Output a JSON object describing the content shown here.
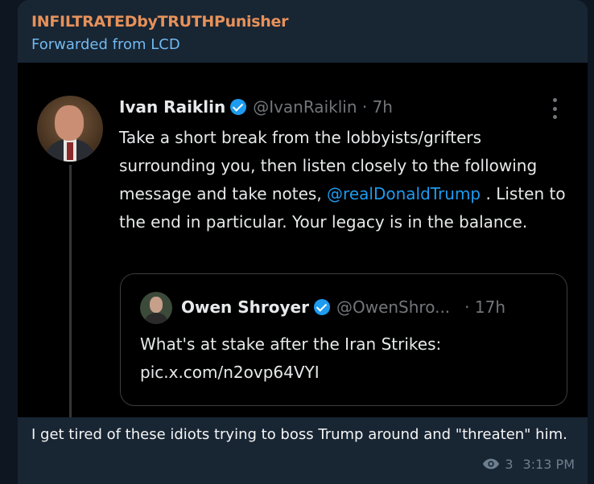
{
  "message": {
    "sender": "INFILTRATEDbyTRUTHPunisher",
    "forwarded_from": "Forwarded from LCD",
    "caption": "I get tired of these idiots trying to boss Trump around and \"threaten\" him.",
    "views": "3",
    "time": "3:13 PM"
  },
  "tweet": {
    "author_name": "Ivan Raiklin",
    "handle_time": "@IvanRaiklin · 7h",
    "text_part1": "Take a short break from the lobbyists/grifters surrounding you, then listen closely to the following message and take notes, ",
    "mention": "@realDonaldTrump",
    "text_part2": " .  Listen to the end in particular.  Your legacy is in the balance.",
    "quoted": {
      "author_name": "Owen Shroyer",
      "handle": "@OwenShro...",
      "time": "· 17h",
      "text_line1": "What's at stake after the Iran Strikes:",
      "text_line2": "pic.x.com/n2ovp64VYI"
    }
  },
  "colors": {
    "background": "#0e1621",
    "bubble": "#182533",
    "sender": "#e6915a",
    "forwarded": "#71baf0",
    "verified": "#1d9bf0",
    "mention": "#1d9bf0"
  },
  "icons": {
    "verified": "verified-badge-icon",
    "more": "more-vertical-icon",
    "views": "eye-icon"
  }
}
